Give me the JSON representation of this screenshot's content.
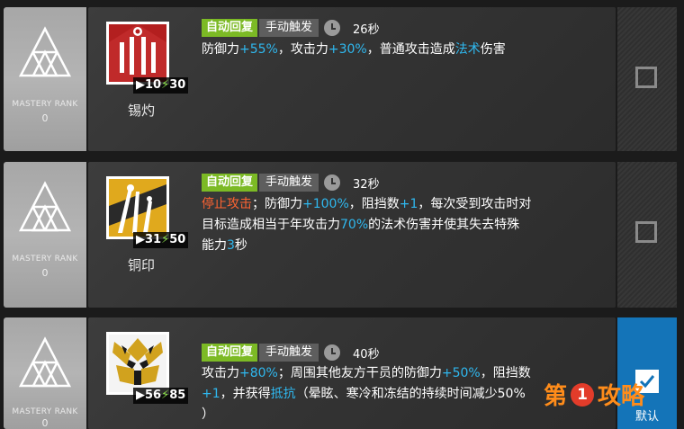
{
  "skills": [
    {
      "mastery_label": "MASTERY RANK",
      "mastery_value": "0",
      "cost_duration": "10",
      "cost_sp": "30",
      "name": "锡灼",
      "tag_auto": "自动回复",
      "tag_manual": "手动触发",
      "duration": "26秒",
      "icon": "red-wrench-tools-icon",
      "desc_lines": [
        [
          [
            "防御力",
            ""
          ],
          [
            "+55%",
            "blue"
          ],
          [
            "，攻击力",
            ""
          ],
          [
            "+30%",
            "blue"
          ],
          [
            "，普通攻击造成",
            ""
          ],
          [
            "法术",
            "blue"
          ],
          [
            "伤害",
            ""
          ]
        ]
      ],
      "selected": false
    },
    {
      "mastery_label": "MASTERY RANK",
      "mastery_value": "0",
      "cost_duration": "31",
      "cost_sp": "50",
      "name": "铜印",
      "tag_auto": "自动回复",
      "tag_manual": "手动触发",
      "duration": "32秒",
      "icon": "gold-tools-icon",
      "desc_lines": [
        [
          [
            "停止攻击",
            "red"
          ],
          [
            "；防御力",
            ""
          ],
          [
            "+100%",
            "blue"
          ],
          [
            "，阻挡数",
            ""
          ],
          [
            "+1",
            "blue"
          ],
          [
            "，每次受到攻击时对",
            ""
          ]
        ],
        [
          [
            "目标造成相当于年攻击力",
            ""
          ],
          [
            "70%",
            "blue"
          ],
          [
            "的法术伤害并使其失去特殊",
            ""
          ]
        ],
        [
          [
            "能力",
            ""
          ],
          [
            "3",
            "blue"
          ],
          [
            "秒",
            ""
          ]
        ]
      ],
      "selected": false
    },
    {
      "mastery_label": "MASTERY RANK",
      "mastery_value": "0",
      "cost_duration": "56",
      "cost_sp": "85",
      "name": "",
      "tag_auto": "自动回复",
      "tag_manual": "手动触发",
      "duration": "40秒",
      "icon": "golden-beast-face-icon",
      "desc_lines": [
        [
          [
            "攻击力",
            ""
          ],
          [
            "+80%",
            "blue"
          ],
          [
            "；周围其他友方干员的防御力",
            ""
          ],
          [
            "+50%",
            "blue"
          ],
          [
            "，阻挡数",
            ""
          ]
        ],
        [
          [
            "+1",
            "blue"
          ],
          [
            "，并获得",
            ""
          ],
          [
            "抵抗",
            "blue"
          ],
          [
            "（晕眩、寒冷和冻结的持续时间减少50%",
            ""
          ]
        ],
        [
          [
            "）",
            ""
          ]
        ]
      ],
      "selected": true,
      "selected_label": "默认"
    }
  ],
  "watermark": {
    "text_left": "第",
    "text_circle": "1",
    "text_right": "攻略"
  },
  "colors": {
    "accent_blue": "#2fb8ef",
    "accent_red": "#ff6432",
    "auto_tag": "#7cba25",
    "selected_bg": "#1474b8"
  }
}
